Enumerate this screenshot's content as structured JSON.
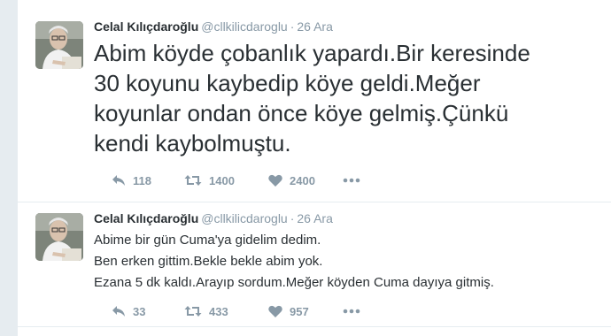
{
  "colors": {
    "text": "#292f33",
    "muted": "#8899a6",
    "background": "#e6ecf0",
    "card": "#ffffff"
  },
  "tweets": [
    {
      "avatar": "profile-photo",
      "fullname": "Celal Kılıçdaroğlu",
      "username": "@cllkilicdaroglu",
      "separator": "·",
      "time": "26 Ara",
      "lines": [
        "Abim köyde çobanlık yapardı.Bir keresinde",
        "30 koyunu kaybedip köye geldi.Meğer",
        "koyunlar ondan önce köye gelmiş.Çünkü",
        "kendi kaybolmuştu."
      ],
      "replies": "118",
      "retweets": "1400",
      "likes": "2400"
    },
    {
      "avatar": "profile-photo",
      "fullname": "Celal Kılıçdaroğlu",
      "username": "@cllkilicdaroglu",
      "separator": "·",
      "time": "26 Ara",
      "lines": [
        "Abime bir gün Cuma'ya gidelim dedim.",
        "Ben erken gittim.Bekle bekle abim yok.",
        "Ezana 5 dk kaldı.Arayıp sordum.Meğer köyden Cuma dayıya gitmiş."
      ],
      "replies": "33",
      "retweets": "433",
      "likes": "957"
    }
  ],
  "icons": {
    "reply": "reply-icon",
    "retweet": "retweet-icon",
    "like": "heart-icon",
    "more": "more-icon"
  }
}
